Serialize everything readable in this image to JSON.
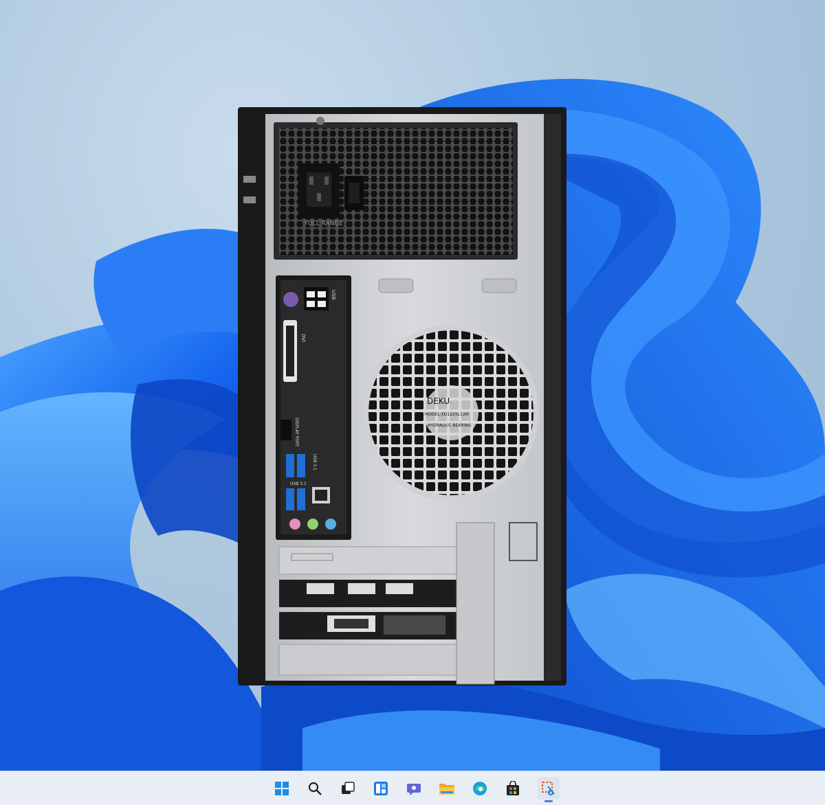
{
  "desktop": {
    "photo_labels": {
      "psu": "FULL RANGE",
      "usb": "USB",
      "dvi": "DVI",
      "displayport": "DISPLAY PORT",
      "usb31_top": "USB 3.1",
      "usb31_bottom": "USB 3.1",
      "fan_brand": "DEKU",
      "fan_model": "MODEL:XD1225L12M",
      "fan_bearing": "HYDRAULIC BEARING"
    },
    "accent_color": "#1a6cf0"
  },
  "taskbar": {
    "icons": [
      {
        "name": "start-icon",
        "active": false
      },
      {
        "name": "search-icon",
        "active": false
      },
      {
        "name": "task-view-icon",
        "active": false
      },
      {
        "name": "widgets-icon",
        "active": false
      },
      {
        "name": "chat-icon",
        "active": false
      },
      {
        "name": "file-explorer-icon",
        "active": false
      },
      {
        "name": "edge-icon",
        "active": false
      },
      {
        "name": "store-icon",
        "active": false
      },
      {
        "name": "snipping-tool-icon",
        "active": true
      }
    ]
  }
}
